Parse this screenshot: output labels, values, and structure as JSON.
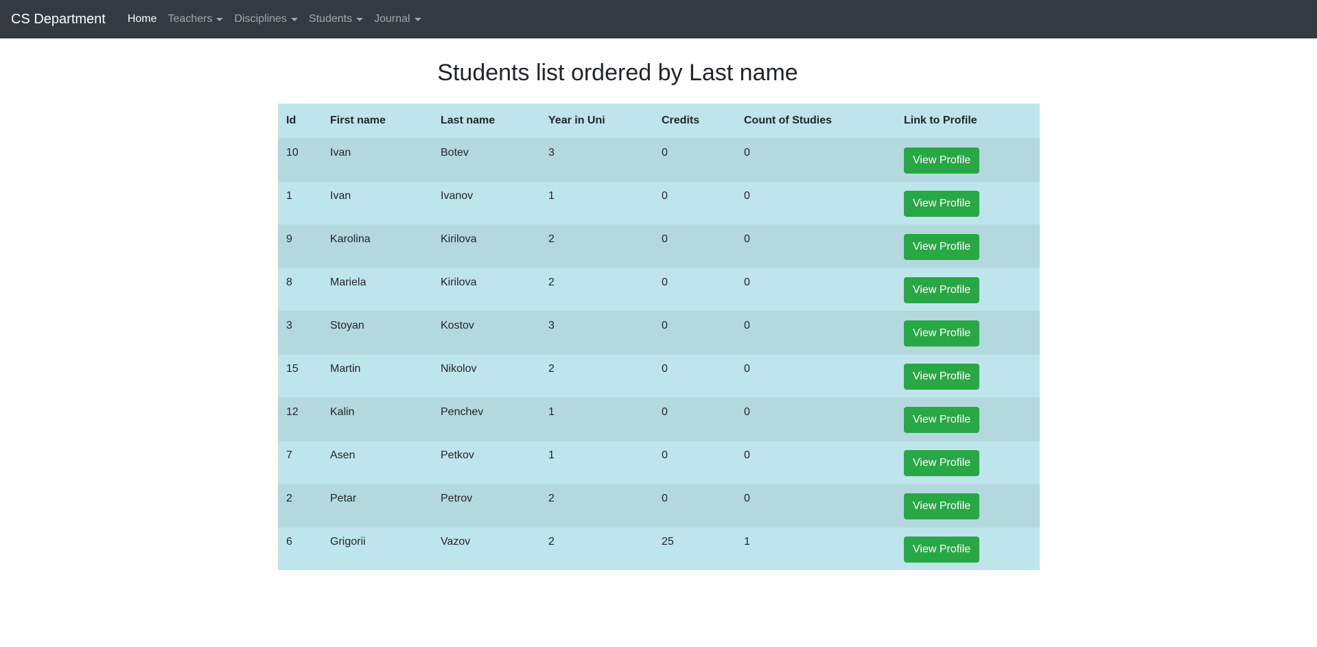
{
  "navbar": {
    "brand": "CS Department",
    "items": [
      {
        "label": "Home",
        "dropdown": false,
        "active": true
      },
      {
        "label": "Teachers",
        "dropdown": true,
        "active": false
      },
      {
        "label": "Disciplines",
        "dropdown": true,
        "active": false
      },
      {
        "label": "Students",
        "dropdown": true,
        "active": false
      },
      {
        "label": "Journal",
        "dropdown": true,
        "active": false
      }
    ]
  },
  "main": {
    "title": "Students list ordered by Last name"
  },
  "table": {
    "headers": [
      "Id",
      "First name",
      "Last name",
      "Year in Uni",
      "Credits",
      "Count of Studies",
      "Link to Profile"
    ],
    "button_label": "View Profile",
    "rows": [
      {
        "id": "10",
        "first": "Ivan",
        "last": "Botev",
        "year": "3",
        "credits": "0",
        "studies": "0"
      },
      {
        "id": "1",
        "first": "Ivan",
        "last": "Ivanov",
        "year": "1",
        "credits": "0",
        "studies": "0"
      },
      {
        "id": "9",
        "first": "Karolina",
        "last": "Kirilova",
        "year": "2",
        "credits": "0",
        "studies": "0"
      },
      {
        "id": "8",
        "first": "Mariela",
        "last": "Kirilova",
        "year": "2",
        "credits": "0",
        "studies": "0"
      },
      {
        "id": "3",
        "first": "Stoyan",
        "last": "Kostov",
        "year": "3",
        "credits": "0",
        "studies": "0"
      },
      {
        "id": "15",
        "first": "Martin",
        "last": "Nikolov",
        "year": "2",
        "credits": "0",
        "studies": "0"
      },
      {
        "id": "12",
        "first": "Kalin",
        "last": "Penchev",
        "year": "1",
        "credits": "0",
        "studies": "0"
      },
      {
        "id": "7",
        "first": "Asen",
        "last": "Petkov",
        "year": "1",
        "credits": "0",
        "studies": "0"
      },
      {
        "id": "2",
        "first": "Petar",
        "last": "Petrov",
        "year": "2",
        "credits": "0",
        "studies": "0"
      },
      {
        "id": "6",
        "first": "Grigorii",
        "last": "Vazov",
        "year": "2",
        "credits": "25",
        "studies": "1"
      }
    ]
  },
  "colors": {
    "navbar_bg": "#343a40",
    "table_bg": "#bee5eb",
    "table_bg_striped": "#b3d9de",
    "button_bg": "#28a745"
  }
}
